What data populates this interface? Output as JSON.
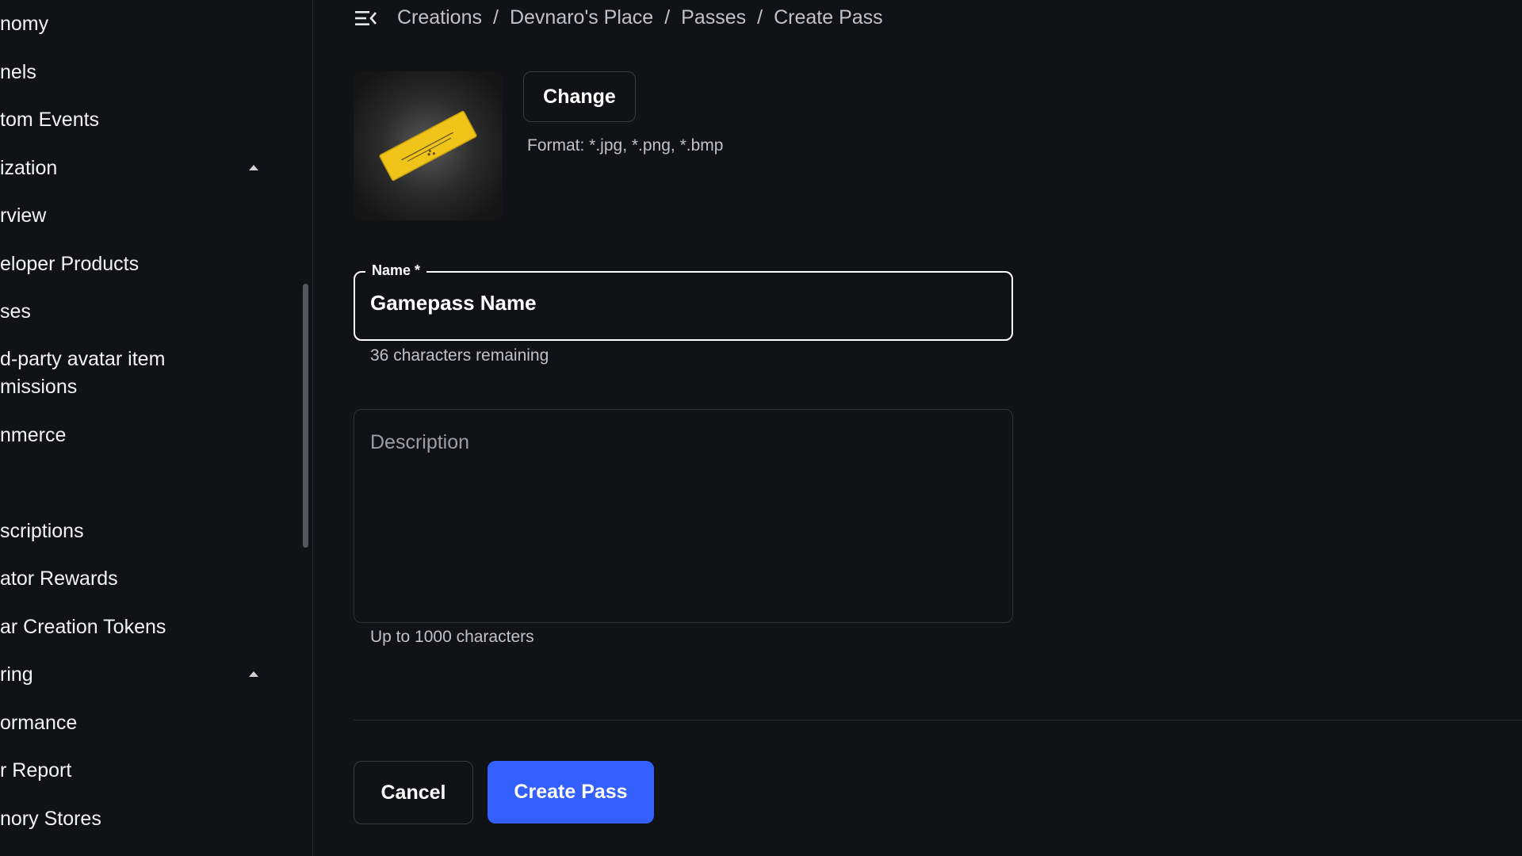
{
  "sidebar": {
    "items": [
      {
        "label": "nomy"
      },
      {
        "label": "nels"
      },
      {
        "label": "tom Events"
      },
      {
        "label": "ization"
      },
      {
        "label": "rview"
      },
      {
        "label": "eloper Products"
      },
      {
        "label": "ses"
      },
      {
        "label": "d-party avatar item"
      },
      {
        "label": "missions"
      },
      {
        "label": "nmerce"
      },
      {
        "label": "scriptions"
      },
      {
        "label": "ator Rewards"
      },
      {
        "label": "ar Creation Tokens"
      },
      {
        "label": "ring"
      },
      {
        "label": "ormance"
      },
      {
        "label": "r Report"
      },
      {
        "label": "nory Stores"
      }
    ]
  },
  "header": {
    "menu_icon": "menu-collapse-icon",
    "breadcrumb": [
      "Creations",
      "Devnaro's Place",
      "Passes",
      "Create Pass"
    ],
    "separator": "/"
  },
  "image": {
    "change_label": "Change",
    "format_text": "Format: *.jpg, *.png, *.bmp",
    "thumbnail_icon": "golden-ticket-icon"
  },
  "name_field": {
    "label": "Name *",
    "value": "Gamepass Name",
    "helper": "36 characters remaining"
  },
  "description_field": {
    "placeholder": "Description",
    "helper": "Up to 1000 characters"
  },
  "actions": {
    "cancel_label": "Cancel",
    "create_label": "Create Pass",
    "primary_color": "#335fff"
  }
}
